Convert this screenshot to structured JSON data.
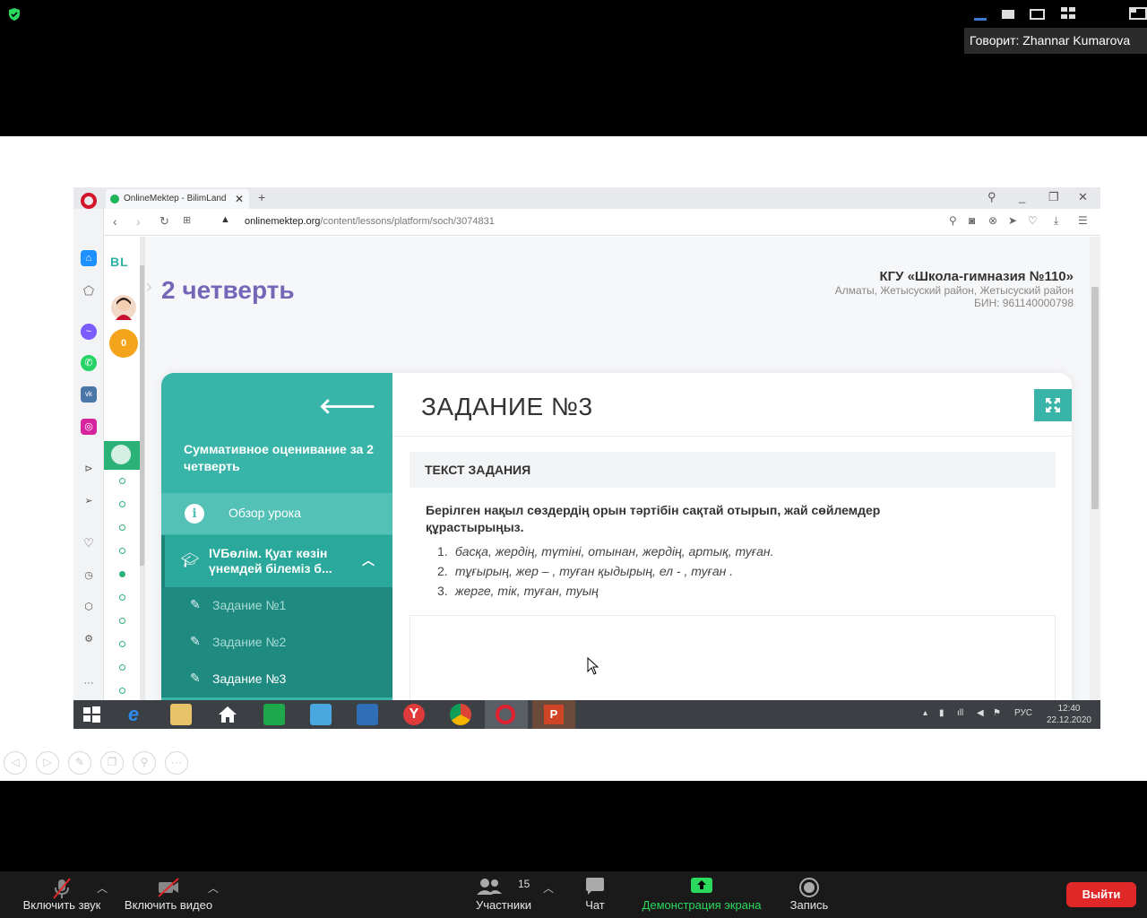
{
  "zoom": {
    "speaker_label": "Говорит: Zhannar Kumarova",
    "controls": {
      "audio_label": "Включить звук",
      "video_label": "Включить видео",
      "participants_label": "Участники",
      "participants_count": "15",
      "chat_label": "Чат",
      "share_label": "Демонстрация экрана",
      "record_label": "Запись",
      "exit_label": "Выйти"
    }
  },
  "browser": {
    "tab_title": "OnlineMektep - BilimLand",
    "url_domain": "onlinemektep.org",
    "url_path": "/content/lessons/platform/soch/3074831"
  },
  "page": {
    "logo": "BL",
    "coins": "0",
    "quarter_title": "2 четверть",
    "school": {
      "name": "КГУ «Школа-гимназия №110»",
      "address": "Алматы, Жетысуский район, Жетысуский район",
      "bin": "БИН: 961140000798"
    }
  },
  "lesson": {
    "title": "Суммативное оценивание за 2 четверть",
    "overview_label": "Обзор урока",
    "section_line1": "IVБөлім. Қуат көзін",
    "section_line2": "үнемдей білеміз б...",
    "tasks": [
      "Задание №1",
      "Задание №2",
      "Задание №3"
    ]
  },
  "task": {
    "title": "ЗАДАНИЕ №3",
    "text_header": "ТЕКСТ ЗАДАНИЯ",
    "instruction": "Берілген нақыл сөздердің орын тәртібін сақтай отырып, жай сөйлемдер құрастырыңыз.",
    "items": [
      {
        "num": "1.",
        "text": "басқа, жердің, түтіні, отынан, жердің, артық, туған."
      },
      {
        "num": "2.",
        "text": "тұғырың, жер – , туған қыдырың, ел - , туған ."
      },
      {
        "num": "3.",
        "text": "жерге, тік, туған, туың"
      }
    ]
  },
  "taskbar": {
    "lang": "РУС",
    "time": "12:40",
    "date": "22.12.2020"
  },
  "colors": {
    "teal": "#38b5a8",
    "teal_dark": "#1f8a80",
    "purple": "#7467b8",
    "exit_red": "#e02828",
    "share_green": "#2bd95e"
  }
}
